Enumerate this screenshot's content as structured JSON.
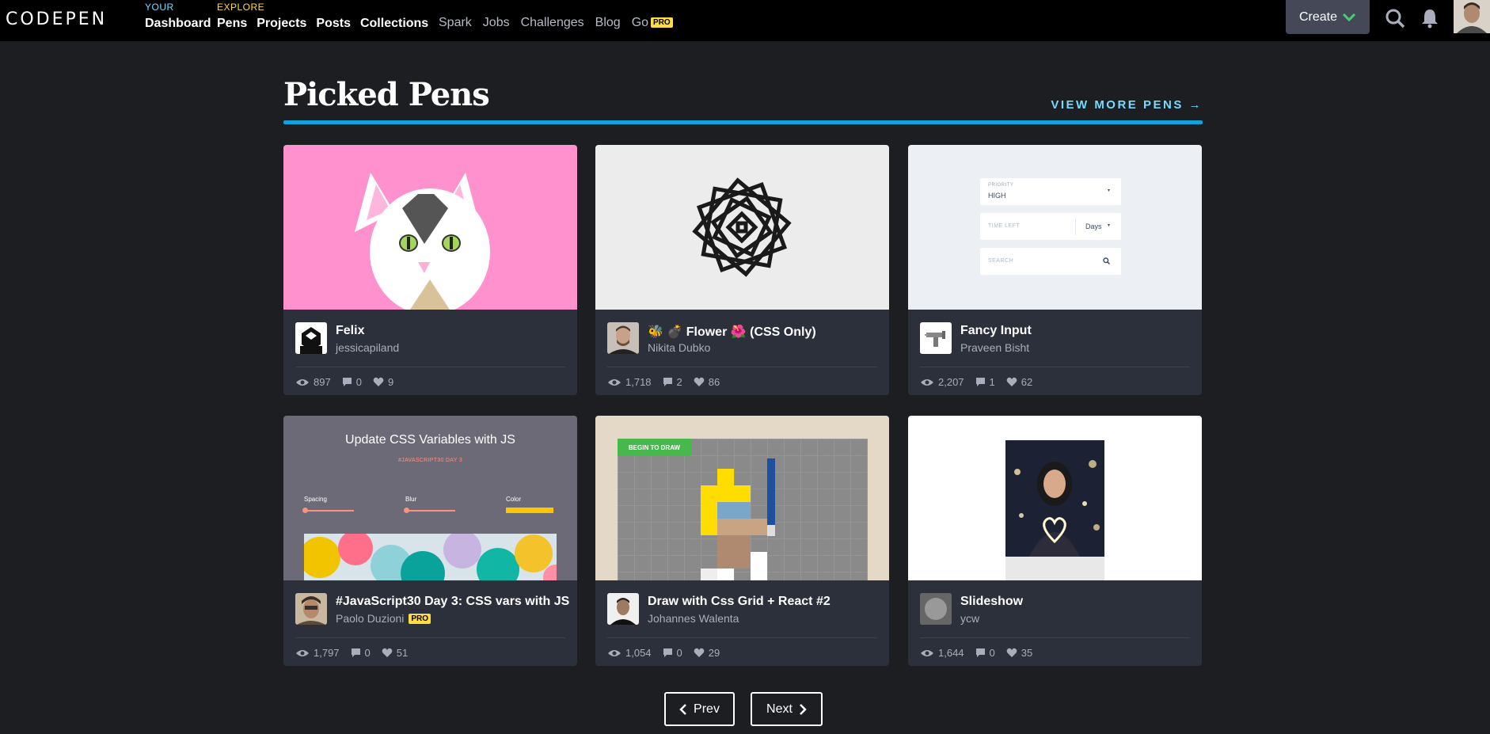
{
  "header": {
    "logo_text": "CODEPEN",
    "your_label": "YOUR",
    "your_links": [
      "Dashboard"
    ],
    "explore_label": "EXPLORE",
    "explore_links": [
      "Pens",
      "Projects",
      "Posts",
      "Collections"
    ],
    "secondary_links": [
      "Spark",
      "Jobs",
      "Challenges",
      "Blog",
      "Go"
    ],
    "go_badge": "PRO",
    "create_label": "Create",
    "icons": [
      "search-icon",
      "bell-icon",
      "user-avatar"
    ],
    "colors": {
      "your": "#76daff",
      "explore": "#ffdd40",
      "create_chevron": "#47cf73"
    }
  },
  "section": {
    "title": "Picked Pens",
    "view_more": "VIEW MORE PENS →",
    "rule_color": "#11a2dc"
  },
  "cards": [
    {
      "title": "Felix",
      "author": "jessicapiland",
      "pro": false,
      "views": "897",
      "comments": "0",
      "likes": "9"
    },
    {
      "title": "🐝 💣 Flower 🌺 (CSS Only)",
      "author": "Nikita Dubko",
      "pro": false,
      "views": "1,718",
      "comments": "2",
      "likes": "86"
    },
    {
      "title": "Fancy Input",
      "author": "Praveen Bisht",
      "pro": false,
      "views": "2,207",
      "comments": "1",
      "likes": "62"
    },
    {
      "title": "#JavaScript30 Day 3: CSS vars with JS",
      "author": "Paolo Duzioni",
      "pro": true,
      "pro_label": "PRO",
      "views": "1,797",
      "comments": "0",
      "likes": "51"
    },
    {
      "title": "Draw with Css Grid + React #2",
      "author": "Johannes Walenta",
      "pro": false,
      "views": "1,054",
      "comments": "0",
      "likes": "29"
    },
    {
      "title": "Slideshow",
      "author": "ycw",
      "pro": false,
      "views": "1,644",
      "comments": "0",
      "likes": "35"
    }
  ],
  "previews": {
    "fancy_input": {
      "priority_label": "PRIORITY",
      "priority_value": "HIGH",
      "time_left_placeholder": "TIME LEFT",
      "days_value": "Days",
      "search_placeholder": "SEARCH"
    },
    "css_vars": {
      "heading": "Update CSS Variables with JS",
      "subheading": "#JAVASCRIPT30 DAY 3",
      "spacing_label": "Spacing",
      "blur_label": "Blur",
      "color_label": "Color"
    },
    "grid_draw": {
      "button_label": "BEGIN TO DRAW"
    }
  },
  "pagination": {
    "prev_label": "Prev",
    "next_label": "Next"
  }
}
